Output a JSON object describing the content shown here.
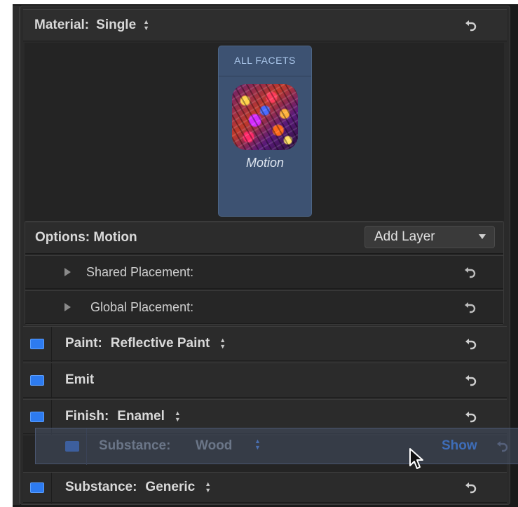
{
  "material": {
    "label": "Material:",
    "value": "Single"
  },
  "facets": {
    "title": "ALL FACETS",
    "items": [
      {
        "name": "Motion"
      }
    ]
  },
  "options": {
    "label": "Options: Motion",
    "add_layer_label": "Add Layer",
    "rows": [
      {
        "label": "Shared Placement:"
      },
      {
        "label": "Global Placement:"
      }
    ]
  },
  "layers": [
    {
      "label": "Paint:",
      "value": "Reflective Paint",
      "has_stepper": true
    },
    {
      "label": "Emit",
      "value": "",
      "has_stepper": false
    },
    {
      "label": "Finish:",
      "value": "Enamel",
      "has_stepper": true
    }
  ],
  "dragged_layer": {
    "label": "Substance:",
    "value": "Wood",
    "show_label": "Show"
  },
  "bottom_layer": {
    "label": "Substance:",
    "value": "Generic"
  },
  "colors": {
    "accent_blue": "#2d7bf0",
    "facet_card": "#3d5272",
    "panel": "#2a2a2a"
  },
  "icons": {
    "reset": "reset-arrow-icon",
    "stepper": "up-down-stepper-icon",
    "disclosure": "disclosure-triangle-icon",
    "checkbox": "checkbox-icon",
    "cursor": "mouse-pointer-icon"
  }
}
